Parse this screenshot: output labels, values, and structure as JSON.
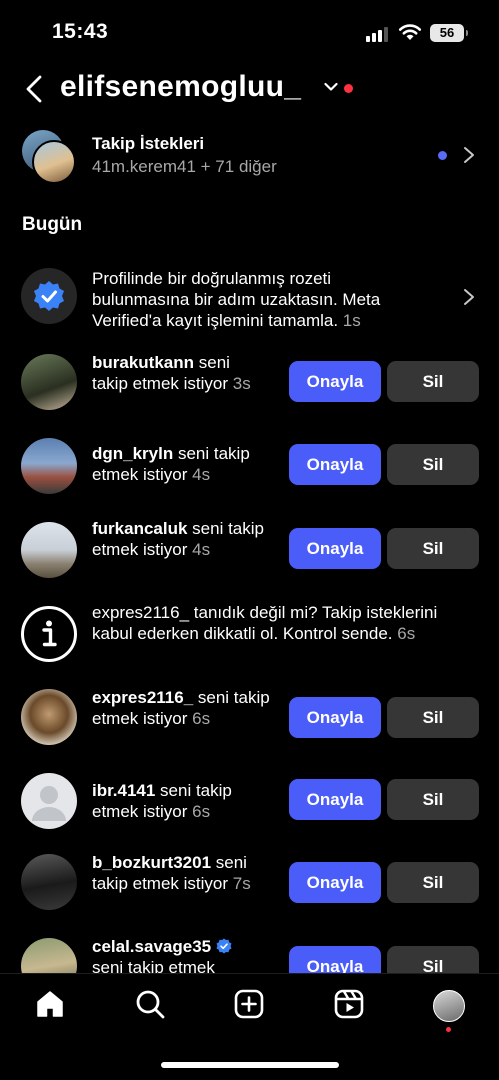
{
  "status_bar": {
    "time": "15:43",
    "battery": "56"
  },
  "header": {
    "username": "elifsenemogluu_"
  },
  "requests": {
    "title": "Takip İstekleri",
    "subtitle": "41m.kerem41 + 71 diğer"
  },
  "section_title": "Bugün",
  "meta_notice": {
    "text": "Profilinde bir doğrulanmış rozeti bulunmasına bir adım uzaktasın. Meta Verified'a kayıt işlemini tamamla.",
    "time": "1s"
  },
  "safety_notice": {
    "username": "expres2116_",
    "text": " tanıdık değil mi? Takip isteklerini kabul ederken dikkatli ol. Kontrol sende.",
    "time": "6s"
  },
  "labels": {
    "approve": "Onayla",
    "delete": "Sil"
  },
  "follow_requests": [
    {
      "username": "burakutkann",
      "text": " seni takip etmek istiyor",
      "time": "3s"
    },
    {
      "username": "dgn_kryln",
      "text": " seni takip etmek istiyor",
      "time": "4s"
    },
    {
      "username": "furkancaluk",
      "text": " seni takip etmek istiyor",
      "time": "4s"
    },
    {
      "username": "expres2116_",
      "text": " seni takip etmek istiyor",
      "time": "6s"
    },
    {
      "username": "ibr.4141",
      "text": " seni takip etmek istiyor",
      "time": "6s"
    },
    {
      "username": "b_bozkurt3201",
      "text": " seni takip etmek istiyor",
      "time": "7s"
    },
    {
      "username": "celal.savage35",
      "text": "seni takip etmek",
      "time": ""
    }
  ],
  "colors": {
    "accent": "#4a5df9",
    "badge_red": "#ff3040",
    "verified_blue": "#3b82f6"
  },
  "icons": [
    "home-icon",
    "search-icon",
    "create-icon",
    "reels-icon",
    "profile-avatar"
  ]
}
